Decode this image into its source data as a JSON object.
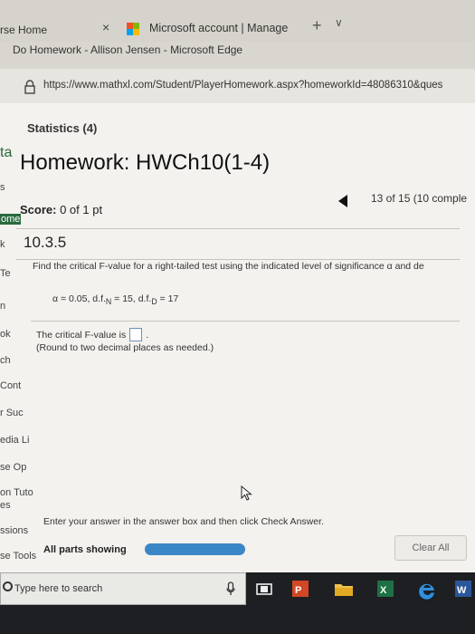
{
  "browser": {
    "prev_tab_label": "rse Home",
    "prev_tab_close": "×",
    "active_tab_label": "Microsoft account | Manage",
    "new_tab_symbol": "+",
    "tab_list_symbol": "∨",
    "window_title": "Do Homework - Allison Jensen - Microsoft Edge",
    "url": "https://www.mathxl.com/Student/PlayerHomework.aspx?homeworkId=48086310&ques"
  },
  "sidebar": {
    "items": [
      "ta",
      "s",
      "ome",
      "k",
      "Te",
      "n",
      "ok",
      "ch",
      "Cont",
      "r Suc",
      "edia Li",
      "se Op",
      "on Tuto",
      "es",
      "ssions",
      "se Tools"
    ]
  },
  "page": {
    "course_title": "Statistics (4)",
    "homework_title": "Homework: HWCh10(1-4)",
    "score_label": "Score:",
    "score_value": "0 of 1 pt",
    "progress": "13 of 15 (10 comple",
    "section_id": "10.3.5",
    "question": "Find the critical F-value for a right-tailed test using the indicated level of significance α and de",
    "params": "α = 0.05, d.f.N = 15, d.f.D = 17",
    "params_parts": {
      "a": "α = 0.05, d.f.",
      "b": "N",
      "c": " = 15, d.f.",
      "d": "D",
      "e": " = 17"
    },
    "answer_prefix": "The critical F-value is",
    "answer_suffix": ".",
    "answer_value": "",
    "round_note": "(Round to two decimal places as needed.)",
    "instruction": "Enter your answer in the answer box and then click Check Answer.",
    "parts_label": "All parts showing",
    "clear_label": "Clear All"
  },
  "taskbar": {
    "search_placeholder": "Type here to search"
  },
  "colors": {
    "accent_blue": "#3b86c6",
    "answer_box_border": "#6b8fb6",
    "taskbar_bg": "#1d1f22"
  },
  "icons": [
    "close-icon",
    "microsoft-logo-icon",
    "plus-icon",
    "chevron-down-icon",
    "lock-icon",
    "back-arrow-icon",
    "mouse-cursor-icon",
    "search-icon",
    "microphone-icon",
    "task-view-icon",
    "powerpoint-icon",
    "file-explorer-icon",
    "excel-icon",
    "edge-icon",
    "word-icon"
  ]
}
